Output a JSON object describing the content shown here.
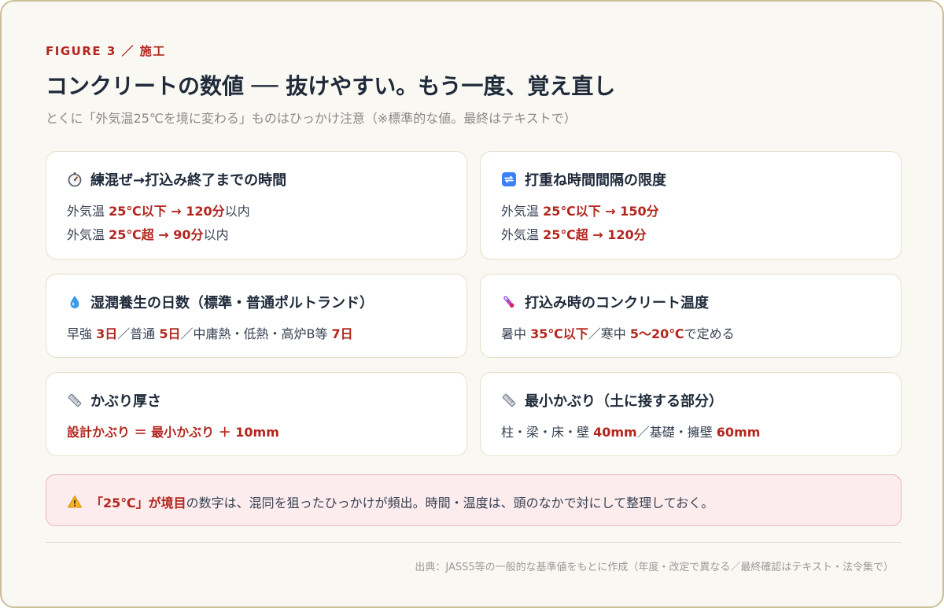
{
  "header": {
    "eyebrow": "FIGURE 3 ／ 施工",
    "title": "コンクリートの数値 ── 抜けやすい。もう一度、覚え直し",
    "subtitle": "とくに「外気温25℃を境に変わる」ものはひっかけ注意（※標準的な値。最終はテキストで）"
  },
  "cards": {
    "mixing": {
      "icon": "stopwatch-icon",
      "title": "練混ぜ→打込み終了までの時間",
      "l1": {
        "a": "外気温 ",
        "b": "25℃以下 → 120分",
        "c": "以内"
      },
      "l2": {
        "a": "外気温 ",
        "b": "25℃超 → 90分",
        "c": "以内"
      }
    },
    "lift": {
      "icon": "repeat-arrows-icon",
      "title": "打重ね時間間隔の限度",
      "l1": {
        "a": "外気温 ",
        "b": "25℃以下 → 150分"
      },
      "l2": {
        "a": "外気温 ",
        "b": "25℃超 → 120分"
      }
    },
    "curing": {
      "icon": "water-drop-icon",
      "title": "湿潤養生の日数（標準・普通ポルトランド）",
      "l1": {
        "a": "早強 ",
        "b": "3日",
        "c": "／普通 ",
        "d": "5日",
        "e": "／中庸熱・低熱・高炉B等 ",
        "f": "7日"
      }
    },
    "temp": {
      "icon": "thermometer-icon",
      "title": "打込み時のコンクリート温度",
      "l1": {
        "a": "暑中 ",
        "b": "35℃以下",
        "c": "／寒中 ",
        "d": "5〜20℃",
        "e": "で定める"
      }
    },
    "cover": {
      "icon": "ruler-icon",
      "title": "かぶり厚さ",
      "l1": "設計かぶり ＝ 最小かぶり ＋ 10mm"
    },
    "mincover": {
      "icon": "ruler-icon",
      "title": "最小かぶり（土に接する部分）",
      "l1": {
        "a": "柱・梁・床・壁 ",
        "b": "40mm",
        "c": "／基礎・擁壁 ",
        "d": "60mm"
      }
    }
  },
  "warning": {
    "icon": "warning-icon",
    "emph": "「25℃」が境目",
    "rest": "の数字は、混同を狙ったひっかけが頻出。時間・温度は、頭のなかで対にして整理しておく。"
  },
  "source": "出典：JASS5等の一般的な基準値をもとに作成（年度・改定で異なる／最終確認はテキスト・法令集で）",
  "colors": {
    "accent": "#b3261e",
    "card_border": "#e6dfc8",
    "warn_bg": "#fcecee",
    "frame_border": "#cbbf9a"
  }
}
